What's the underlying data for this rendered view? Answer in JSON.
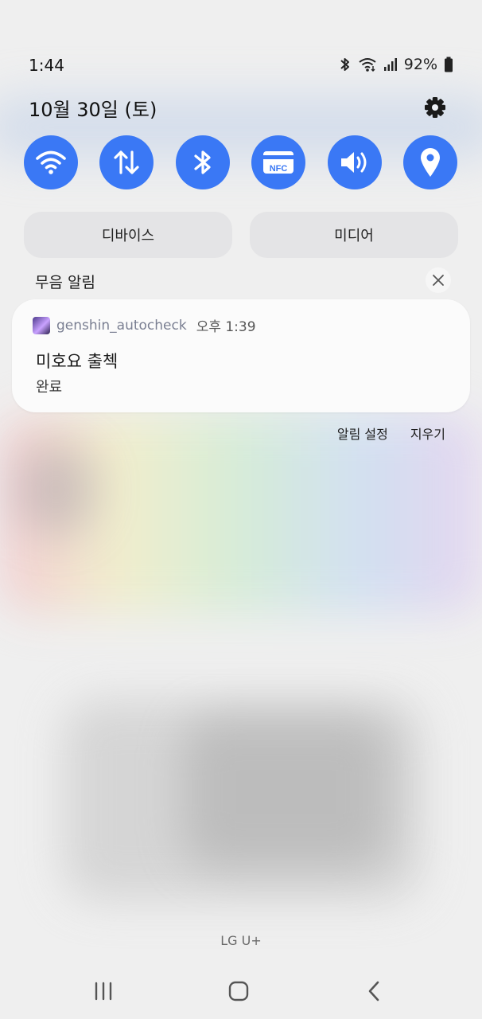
{
  "status_bar": {
    "time": "1:44",
    "battery": "92%",
    "icons": [
      "bluetooth-icon",
      "wifi-icon",
      "signal-icon",
      "battery-icon"
    ]
  },
  "panel": {
    "date": "10월 30일 (토)",
    "settings_icon": "gear-icon"
  },
  "quick_settings": [
    {
      "name": "wifi",
      "icon": "wifi-icon"
    },
    {
      "name": "mobile-data",
      "icon": "data-arrows-icon"
    },
    {
      "name": "bluetooth",
      "icon": "bluetooth-icon"
    },
    {
      "name": "nfc",
      "icon": "nfc-icon",
      "label": "NFC"
    },
    {
      "name": "sound",
      "icon": "volume-icon"
    },
    {
      "name": "location",
      "icon": "location-icon"
    }
  ],
  "pills": {
    "devices": "디바이스",
    "media": "미디어"
  },
  "silent": {
    "title": "무음 알림"
  },
  "notification": {
    "app_name": "genshin_autocheck",
    "time": "오후 1:39",
    "title": "미호요 출첵",
    "text": "완료"
  },
  "actions": {
    "settings": "알림 설정",
    "clear": "지우기"
  },
  "carrier": "LG U+",
  "colors": {
    "accent": "#3a78f5",
    "background": "#efefef",
    "card": "#fbfbfb"
  }
}
